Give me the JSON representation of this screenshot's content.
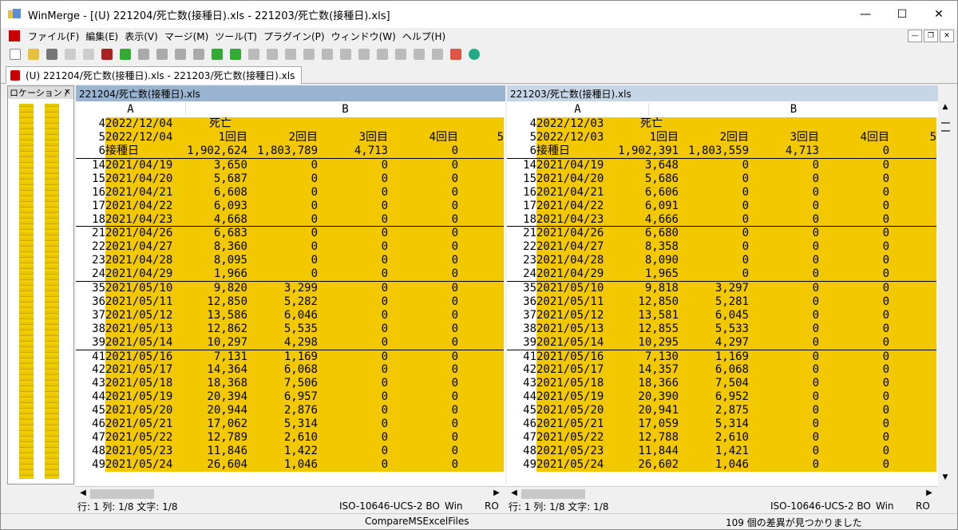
{
  "window": {
    "title": "WinMerge - [(U) 221204/死亡数(接種日).xls - 221203/死亡数(接種日).xls]"
  },
  "menu": [
    "ファイル(F)",
    "編集(E)",
    "表示(V)",
    "マージ(M)",
    "ツール(T)",
    "プラグイン(P)",
    "ウィンドウ(W)",
    "ヘルプ(H)"
  ],
  "tab": {
    "label": "(U) 221204/死亡数(接種日).xls - 221203/死亡数(接種日).xls"
  },
  "location_pane": {
    "title": "ロケーション /",
    "close": "×"
  },
  "left": {
    "header": "221204/死亡数(接種日).xls",
    "col_a": "A",
    "col_b": "B",
    "rows": [
      {
        "n": "4",
        "a": "2022/12/04",
        "v": [
          "死亡",
          "",
          "",
          ""
        ],
        "hdr": true
      },
      {
        "n": "5",
        "a": "2022/12/04",
        "v": [
          "1回目",
          "2回目",
          "3回目",
          "4回目"
        ],
        "extra": "5"
      },
      {
        "n": "6",
        "a": "接種日",
        "v": [
          "1,902,624",
          "1,803,789",
          "4,713",
          "0"
        ]
      },
      {
        "n": "14",
        "a": "2021/04/19",
        "v": [
          "3,650",
          "0",
          "0",
          "0"
        ],
        "sep": true
      },
      {
        "n": "15",
        "a": "2021/04/20",
        "v": [
          "5,687",
          "0",
          "0",
          "0"
        ]
      },
      {
        "n": "16",
        "a": "2021/04/21",
        "v": [
          "6,608",
          "0",
          "0",
          "0"
        ]
      },
      {
        "n": "17",
        "a": "2021/04/22",
        "v": [
          "6,093",
          "0",
          "0",
          "0"
        ]
      },
      {
        "n": "18",
        "a": "2021/04/23",
        "v": [
          "4,668",
          "0",
          "0",
          "0"
        ]
      },
      {
        "n": "21",
        "a": "2021/04/26",
        "v": [
          "6,683",
          "0",
          "0",
          "0"
        ],
        "sep": true
      },
      {
        "n": "22",
        "a": "2021/04/27",
        "v": [
          "8,360",
          "0",
          "0",
          "0"
        ]
      },
      {
        "n": "23",
        "a": "2021/04/28",
        "v": [
          "8,095",
          "0",
          "0",
          "0"
        ]
      },
      {
        "n": "24",
        "a": "2021/04/29",
        "v": [
          "1,966",
          "0",
          "0",
          "0"
        ]
      },
      {
        "n": "35",
        "a": "2021/05/10",
        "v": [
          "9,820",
          "3,299",
          "0",
          "0"
        ],
        "sep": true
      },
      {
        "n": "36",
        "a": "2021/05/11",
        "v": [
          "12,850",
          "5,282",
          "0",
          "0"
        ]
      },
      {
        "n": "37",
        "a": "2021/05/12",
        "v": [
          "13,586",
          "6,046",
          "0",
          "0"
        ]
      },
      {
        "n": "38",
        "a": "2021/05/13",
        "v": [
          "12,862",
          "5,535",
          "0",
          "0"
        ]
      },
      {
        "n": "39",
        "a": "2021/05/14",
        "v": [
          "10,297",
          "4,298",
          "0",
          "0"
        ]
      },
      {
        "n": "41",
        "a": "2021/05/16",
        "v": [
          "7,131",
          "1,169",
          "0",
          "0"
        ],
        "sep": true
      },
      {
        "n": "42",
        "a": "2021/05/17",
        "v": [
          "14,364",
          "6,068",
          "0",
          "0"
        ]
      },
      {
        "n": "43",
        "a": "2021/05/18",
        "v": [
          "18,368",
          "7,506",
          "0",
          "0"
        ]
      },
      {
        "n": "44",
        "a": "2021/05/19",
        "v": [
          "20,394",
          "6,957",
          "0",
          "0"
        ]
      },
      {
        "n": "45",
        "a": "2021/05/20",
        "v": [
          "20,944",
          "2,876",
          "0",
          "0"
        ]
      },
      {
        "n": "46",
        "a": "2021/05/21",
        "v": [
          "17,062",
          "5,314",
          "0",
          "0"
        ]
      },
      {
        "n": "47",
        "a": "2021/05/22",
        "v": [
          "12,789",
          "2,610",
          "0",
          "0"
        ]
      },
      {
        "n": "48",
        "a": "2021/05/23",
        "v": [
          "11,846",
          "1,422",
          "0",
          "0"
        ]
      },
      {
        "n": "49",
        "a": "2021/05/24",
        "v": [
          "26,604",
          "1,046",
          "0",
          "0"
        ]
      }
    ],
    "status": {
      "pos": "行: 1  列: 1/8  文字: 1/8",
      "enc": "ISO-10646-UCS-2 BOM",
      "eol": "Win",
      "ro": "RO"
    }
  },
  "right": {
    "header": "221203/死亡数(接種日).xls",
    "col_a": "A",
    "col_b": "B",
    "rows": [
      {
        "n": "4",
        "a": "2022/12/03",
        "v": [
          "死亡",
          "",
          "",
          ""
        ],
        "hdr": true
      },
      {
        "n": "5",
        "a": "2022/12/03",
        "v": [
          "1回目",
          "2回目",
          "3回目",
          "4回目"
        ],
        "extra": "5"
      },
      {
        "n": "6",
        "a": "接種日",
        "v": [
          "1,902,391",
          "1,803,559",
          "4,713",
          "0"
        ]
      },
      {
        "n": "14",
        "a": "2021/04/19",
        "v": [
          "3,648",
          "0",
          "0",
          "0"
        ],
        "sep": true
      },
      {
        "n": "15",
        "a": "2021/04/20",
        "v": [
          "5,686",
          "0",
          "0",
          "0"
        ]
      },
      {
        "n": "16",
        "a": "2021/04/21",
        "v": [
          "6,606",
          "0",
          "0",
          "0"
        ]
      },
      {
        "n": "17",
        "a": "2021/04/22",
        "v": [
          "6,091",
          "0",
          "0",
          "0"
        ]
      },
      {
        "n": "18",
        "a": "2021/04/23",
        "v": [
          "4,666",
          "0",
          "0",
          "0"
        ]
      },
      {
        "n": "21",
        "a": "2021/04/26",
        "v": [
          "6,680",
          "0",
          "0",
          "0"
        ],
        "sep": true
      },
      {
        "n": "22",
        "a": "2021/04/27",
        "v": [
          "8,358",
          "0",
          "0",
          "0"
        ]
      },
      {
        "n": "23",
        "a": "2021/04/28",
        "v": [
          "8,090",
          "0",
          "0",
          "0"
        ]
      },
      {
        "n": "24",
        "a": "2021/04/29",
        "v": [
          "1,965",
          "0",
          "0",
          "0"
        ]
      },
      {
        "n": "35",
        "a": "2021/05/10",
        "v": [
          "9,818",
          "3,297",
          "0",
          "0"
        ],
        "sep": true
      },
      {
        "n": "36",
        "a": "2021/05/11",
        "v": [
          "12,850",
          "5,281",
          "0",
          "0"
        ]
      },
      {
        "n": "37",
        "a": "2021/05/12",
        "v": [
          "13,581",
          "6,045",
          "0",
          "0"
        ]
      },
      {
        "n": "38",
        "a": "2021/05/13",
        "v": [
          "12,855",
          "5,533",
          "0",
          "0"
        ]
      },
      {
        "n": "39",
        "a": "2021/05/14",
        "v": [
          "10,295",
          "4,297",
          "0",
          "0"
        ]
      },
      {
        "n": "41",
        "a": "2021/05/16",
        "v": [
          "7,130",
          "1,169",
          "0",
          "0"
        ],
        "sep": true
      },
      {
        "n": "42",
        "a": "2021/05/17",
        "v": [
          "14,357",
          "6,068",
          "0",
          "0"
        ]
      },
      {
        "n": "43",
        "a": "2021/05/18",
        "v": [
          "18,366",
          "7,504",
          "0",
          "0"
        ]
      },
      {
        "n": "44",
        "a": "2021/05/19",
        "v": [
          "20,390",
          "6,952",
          "0",
          "0"
        ]
      },
      {
        "n": "45",
        "a": "2021/05/20",
        "v": [
          "20,941",
          "2,875",
          "0",
          "0"
        ]
      },
      {
        "n": "46",
        "a": "2021/05/21",
        "v": [
          "17,059",
          "5,314",
          "0",
          "0"
        ]
      },
      {
        "n": "47",
        "a": "2021/05/22",
        "v": [
          "12,788",
          "2,610",
          "0",
          "0"
        ]
      },
      {
        "n": "48",
        "a": "2021/05/23",
        "v": [
          "11,844",
          "1,421",
          "0",
          "0"
        ]
      },
      {
        "n": "49",
        "a": "2021/05/24",
        "v": [
          "26,602",
          "1,046",
          "0",
          "0"
        ]
      }
    ],
    "status": {
      "pos": "行: 1  列: 1/8  文字: 1/8",
      "enc": "ISO-10646-UCS-2 BOM",
      "eol": "Win",
      "ro": "RO"
    }
  },
  "bottom": {
    "plugin": "CompareMSExcelFiles",
    "diffs": "109 個の差異が見つかりました"
  },
  "colors": {
    "diff": "#f2c800",
    "left_header": "#99b4d1",
    "right_header": "#c7d6e6"
  }
}
